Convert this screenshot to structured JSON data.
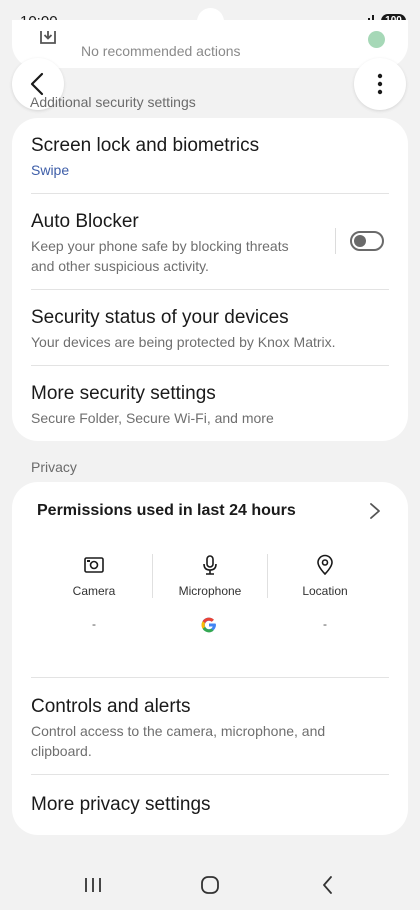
{
  "status_bar": {
    "time": "10:00",
    "battery": "100"
  },
  "top_card": {
    "text": "No recommended actions"
  },
  "sections": {
    "additional_label": "Additional security settings",
    "privacy_label": "Privacy"
  },
  "security": {
    "screen_lock": {
      "title": "Screen lock and biometrics",
      "sub": "Swipe"
    },
    "auto_blocker": {
      "title": "Auto Blocker",
      "sub_line1": "Keep your phone safe by blocking threats",
      "sub_line2": "and other suspicious activity.",
      "enabled": false
    },
    "device_status": {
      "title": "Security status of your devices",
      "sub": "Your devices are being protected by Knox Matrix."
    },
    "more_security": {
      "title": "More security settings",
      "sub": "Secure Folder, Secure Wi-Fi, and more"
    }
  },
  "privacy": {
    "permissions_title": "Permissions used in last 24 hours",
    "permissions": [
      {
        "label": "Camera",
        "icon": "camera-icon",
        "usage": "-"
      },
      {
        "label": "Microphone",
        "icon": "microphone-icon",
        "usage": "google-icon"
      },
      {
        "label": "Location",
        "icon": "location-icon",
        "usage": "-"
      }
    ],
    "controls": {
      "title": "Controls and alerts",
      "sub_line1": "Control access to the camera, microphone, and",
      "sub_line2": "clipboard."
    },
    "more_privacy": {
      "title": "More privacy settings"
    }
  },
  "colors": {
    "accent_blue": "#3e5ea8",
    "background": "#f2f2f2",
    "card": "#ffffff"
  }
}
